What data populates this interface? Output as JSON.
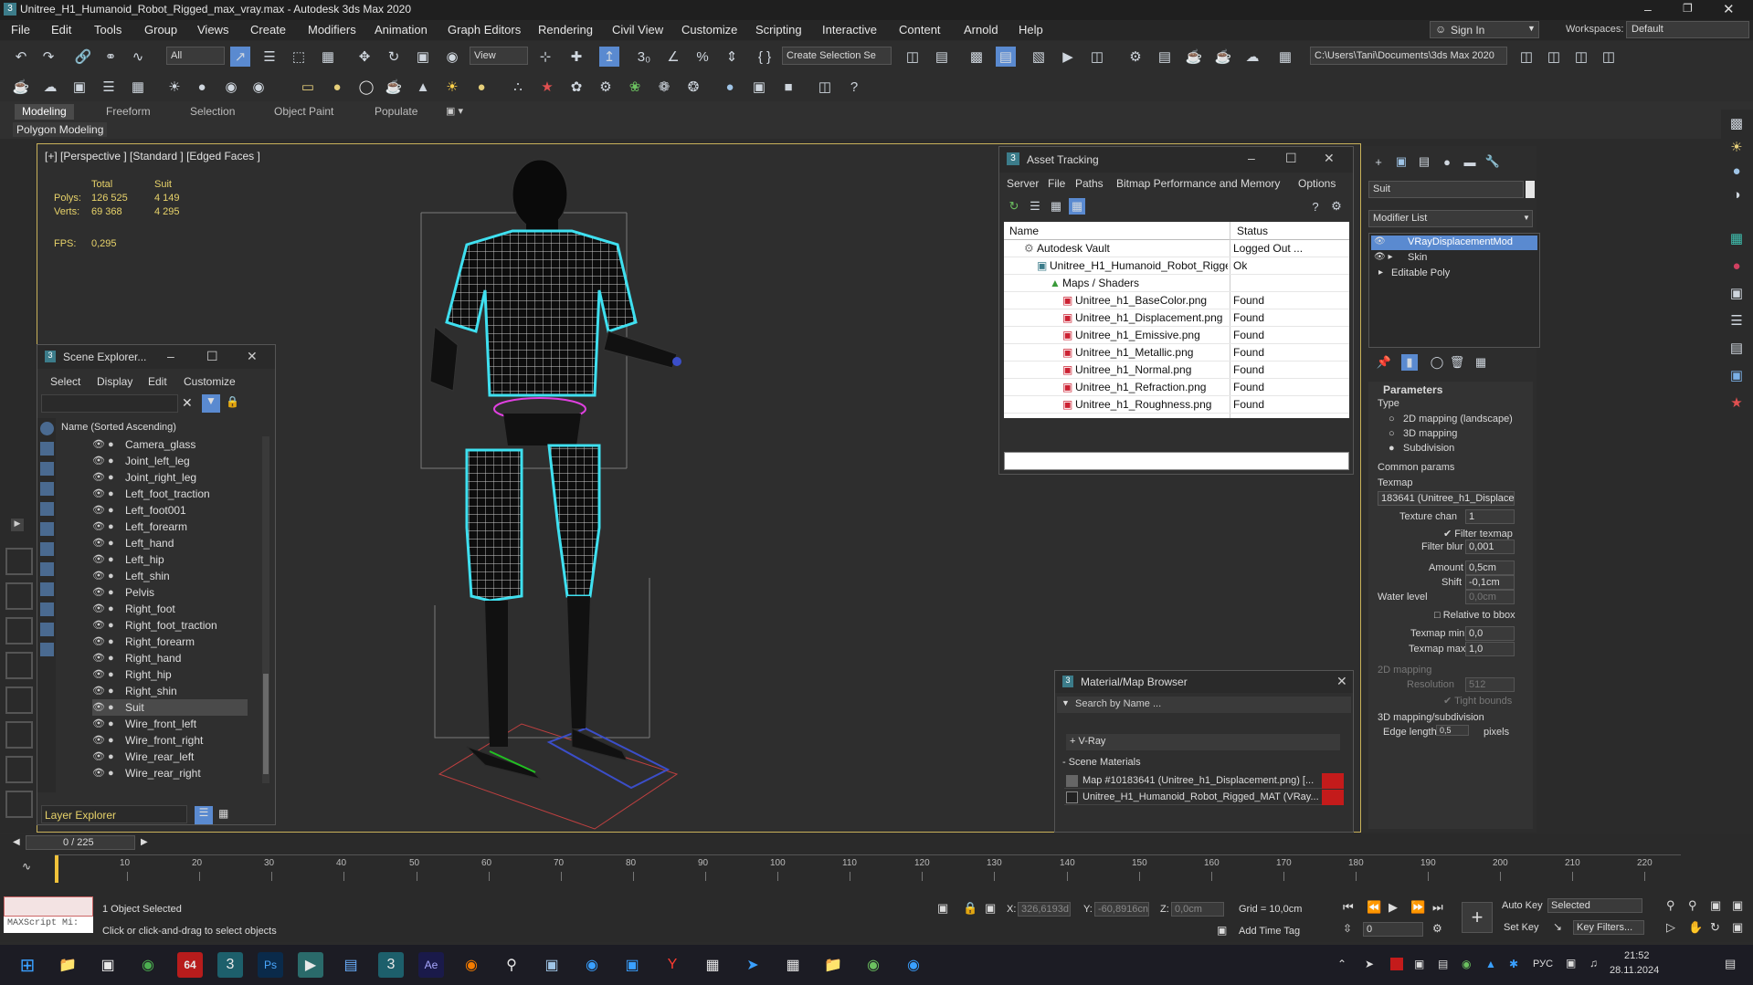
{
  "window": {
    "title": "Unitree_H1_Humanoid_Robot_Rigged_max_vray.max - Autodesk 3ds Max 2020"
  },
  "menu": [
    "File",
    "Edit",
    "Tools",
    "Group",
    "Views",
    "Create",
    "Modifiers",
    "Animation",
    "Graph Editors",
    "Rendering",
    "Civil View",
    "Customize",
    "Scripting",
    "Interactive",
    "Content",
    "Arnold",
    "Help"
  ],
  "account": {
    "signin": "Sign In",
    "workspaces_label": "Workspaces:",
    "workspace": "Default"
  },
  "toolbar": {
    "selection_filter": "All",
    "ref_coord": "View",
    "selection_set": "Create Selection Se",
    "path": "C:\\Users\\Tani\\Documents\\3ds Max 2020"
  },
  "ribbon": {
    "tabs": [
      "Modeling",
      "Freeform",
      "Selection",
      "Object Paint",
      "Populate"
    ],
    "active": "Modeling",
    "panel": "Polygon Modeling"
  },
  "viewport": {
    "label": "[+] [Perspective ] [Standard ] [Edged Faces ]",
    "stats": {
      "col_total": "Total",
      "col_suit": "Suit",
      "polys_label": "Polys:",
      "polys_total": "126 525",
      "polys_suit": "4 149",
      "verts_label": "Verts:",
      "verts_total": "69 368",
      "verts_suit": "4 295",
      "fps_label": "FPS:",
      "fps": "0,295"
    }
  },
  "asset_tracking": {
    "title": "Asset Tracking",
    "menu": [
      "Server",
      "File",
      "Paths",
      "Bitmap Performance and Memory",
      "Options"
    ],
    "col_name": "Name",
    "col_status": "Status",
    "rows": [
      {
        "name": "Autodesk Vault",
        "status": "Logged Out ..."
      },
      {
        "name": "Unitree_H1_Humanoid_Robot_Rigged_max...",
        "status": "Ok"
      },
      {
        "name": "Maps / Shaders",
        "status": ""
      },
      {
        "name": "Unitree_h1_BaseColor.png",
        "status": "Found"
      },
      {
        "name": "Unitree_h1_Displacement.png",
        "status": "Found"
      },
      {
        "name": "Unitree_h1_Emissive.png",
        "status": "Found"
      },
      {
        "name": "Unitree_h1_Metallic.png",
        "status": "Found"
      },
      {
        "name": "Unitree_h1_Normal.png",
        "status": "Found"
      },
      {
        "name": "Unitree_h1_Refraction.png",
        "status": "Found"
      },
      {
        "name": "Unitree_h1_Roughness.png",
        "status": "Found"
      }
    ]
  },
  "scene_explorer": {
    "title": "Scene Explorer...",
    "menu": [
      "Select",
      "Display",
      "Edit",
      "Customize"
    ],
    "header": "Name (Sorted Ascending)",
    "layer": "Layer Explorer",
    "items": [
      "Camera_glass",
      "Joint_left_leg",
      "Joint_right_leg",
      "Left_foot_traction",
      "Left_foot001",
      "Left_forearm",
      "Left_hand",
      "Left_hip",
      "Left_shin",
      "Pelvis",
      "Right_foot",
      "Right_foot_traction",
      "Right_forearm",
      "Right_hand",
      "Right_hip",
      "Right_shin",
      "Suit",
      "Wire_front_left",
      "Wire_front_right",
      "Wire_rear_left",
      "Wire_rear_right"
    ],
    "selected": "Suit"
  },
  "command_panel": {
    "object_name": "Suit",
    "modifier_list": "Modifier List",
    "stack": [
      "VRayDisplacementMod",
      "Skin",
      "Editable Poly"
    ],
    "parameters": {
      "header": "Parameters",
      "type_label": "Type",
      "type_opts": [
        "2D mapping (landscape)",
        "3D mapping",
        "Subdivision"
      ],
      "common": "Common params",
      "texmap_label": "Texmap",
      "texmap": "183641 (Unitree_h1_Displacen",
      "tex_chan_label": "Texture chan",
      "tex_chan": "1",
      "filter_texmap": "Filter texmap",
      "filter_blur_label": "Filter blur",
      "filter_blur": "0,001",
      "amount_label": "Amount",
      "amount": "0,5cm",
      "shift_label": "Shift",
      "shift": "-0,1cm",
      "water_label": "Water level",
      "water": "0,0cm",
      "relative": "Relative to bbox",
      "tmin_label": "Texmap min",
      "tmin": "0,0",
      "tmax_label": "Texmap max",
      "tmax": "1,0",
      "map2d": "2D mapping",
      "res_label": "Resolution",
      "res": "512",
      "tight": "Tight bounds",
      "map3d": "3D mapping/subdivision",
      "edge_label": "Edge length",
      "edge": "0,5",
      "pixels": "pixels"
    }
  },
  "material_browser": {
    "title": "Material/Map Browser",
    "search": "Search by Name ...",
    "cats": [
      "+ V-Ray"
    ],
    "scene_materials": "- Scene Materials",
    "mats": [
      "Map #10183641 (Unitree_h1_Displacement.png) [...",
      "Unitree_H1_Humanoid_Robot_Rigged_MAT (VRay..."
    ]
  },
  "timeline": {
    "frame": "0 / 225",
    "ticks": [
      "10",
      "20",
      "30",
      "40",
      "50",
      "60",
      "70",
      "80",
      "90",
      "100",
      "110",
      "120",
      "130",
      "140",
      "150",
      "160",
      "170",
      "180",
      "190",
      "200",
      "210",
      "220"
    ]
  },
  "status": {
    "script": "MAXScript Mi:",
    "selected": "1 Object Selected",
    "hint": "Click or click-and-drag to select objects",
    "x_label": "X:",
    "x": "326,6193d",
    "y_label": "Y:",
    "y": "-60,8916cn",
    "z_label": "Z:",
    "z": "0,0cm",
    "grid": "Grid = 10,0cm",
    "add_time_tag": "Add Time Tag",
    "autokey": "Auto Key",
    "setkey": "Set Key",
    "sel_mode": "Selected",
    "key_filters": "Key Filters...",
    "frame_field": "0"
  },
  "taskbar": {
    "lang": "РУС",
    "time": "21:52",
    "date": "28.11.2024",
    "badge": "64"
  }
}
